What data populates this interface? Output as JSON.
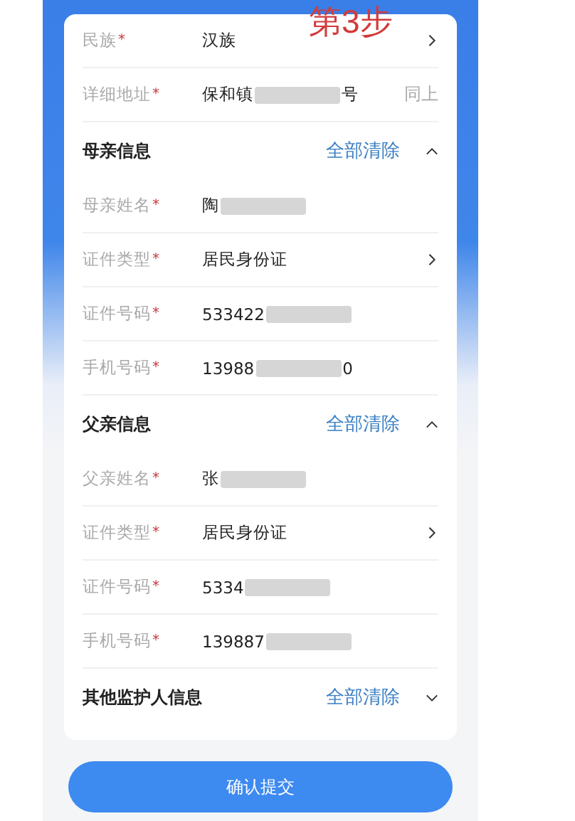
{
  "annotation": "第3步",
  "top_rows": [
    {
      "label": "民族",
      "mark": "*",
      "value": "汉族",
      "redacted": false,
      "kind": "select"
    },
    {
      "label": "详细地址",
      "mark": "*",
      "value": "保和镇",
      "redacted": true,
      "value_tail": "号",
      "kind": "text",
      "action": "同上"
    }
  ],
  "sections": [
    {
      "title": "母亲信息",
      "clear": "全部清除",
      "expanded": true,
      "rows": [
        {
          "label": "母亲姓名",
          "mark": "*",
          "value": "陶",
          "redacted": true,
          "kind": "text"
        },
        {
          "label": "证件类型",
          "mark": "*",
          "value": "居民身份证",
          "redacted": false,
          "kind": "select"
        },
        {
          "label": "证件号码",
          "mark": "*",
          "value": "533422",
          "redacted": true,
          "kind": "text"
        },
        {
          "label": "手机号码",
          "mark": "*",
          "value": "13988",
          "redacted": true,
          "value_tail": "0",
          "kind": "text"
        }
      ]
    },
    {
      "title": "父亲信息",
      "clear": "全部清除",
      "expanded": true,
      "rows": [
        {
          "label": "父亲姓名",
          "mark": "*",
          "value": "张",
          "redacted": true,
          "kind": "text"
        },
        {
          "label": "证件类型",
          "mark": "*",
          "value": "居民身份证",
          "redacted": false,
          "kind": "select"
        },
        {
          "label": "证件号码",
          "mark": "*",
          "value": "5334",
          "redacted": true,
          "kind": "text"
        },
        {
          "label": "手机号码",
          "mark": "*",
          "value": "139887",
          "redacted": true,
          "kind": "text"
        }
      ]
    },
    {
      "title": "其他监护人信息",
      "clear": "全部清除",
      "expanded": false
    }
  ],
  "submit": "确认提交"
}
